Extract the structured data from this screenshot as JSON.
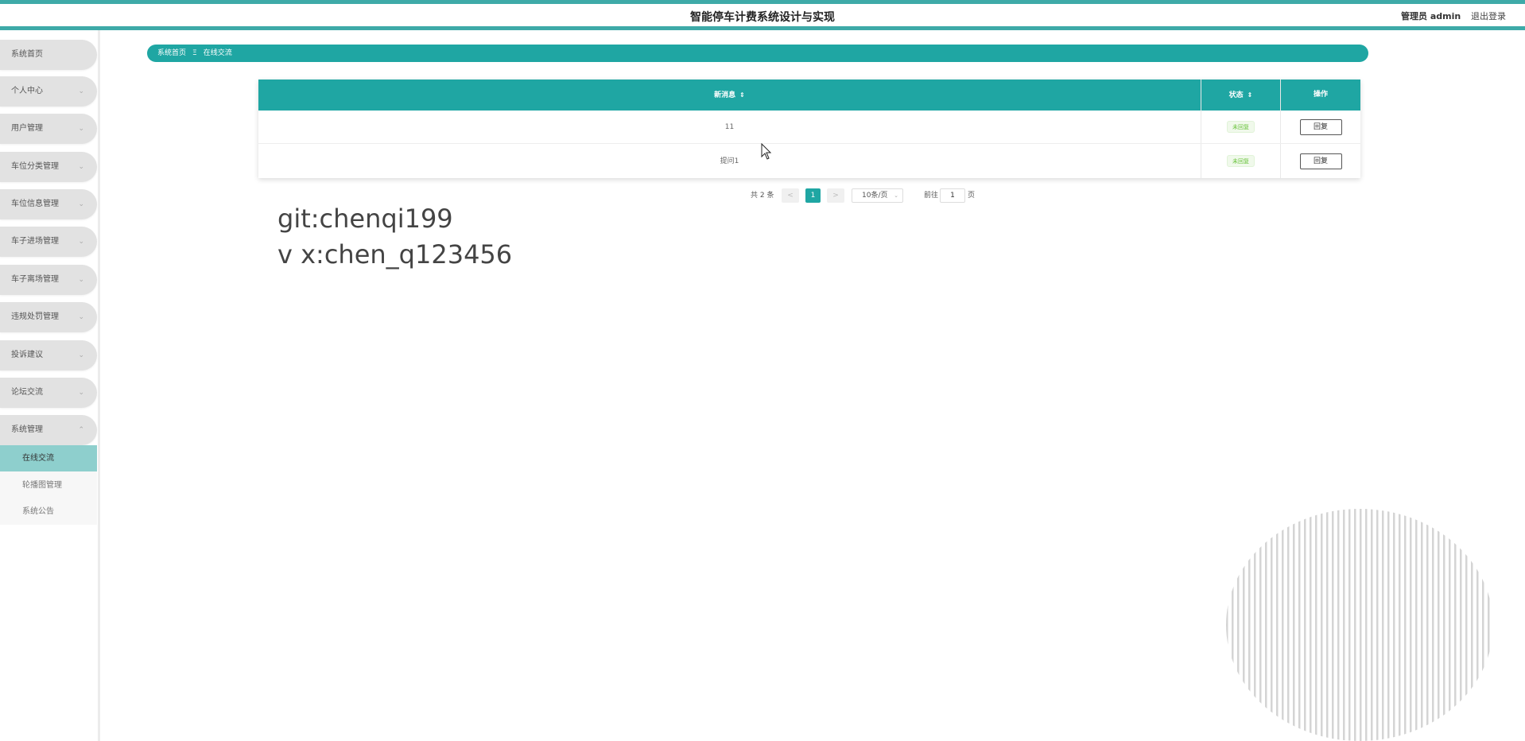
{
  "header": {
    "title": "智能停车计费系统设计与实现",
    "user": "管理员 admin",
    "logout": "退出登录"
  },
  "sidebar": {
    "items": [
      {
        "label": "系统首页",
        "chevron": ""
      },
      {
        "label": "个人中心",
        "chevron": "⌄"
      },
      {
        "label": "用户管理",
        "chevron": "⌄"
      },
      {
        "label": "车位分类管理",
        "chevron": "⌄"
      },
      {
        "label": "车位信息管理",
        "chevron": "⌄"
      },
      {
        "label": "车子进场管理",
        "chevron": "⌄"
      },
      {
        "label": "车子离场管理",
        "chevron": "⌄"
      },
      {
        "label": "违规处罚管理",
        "chevron": "⌄"
      },
      {
        "label": "投诉建议",
        "chevron": "⌄"
      },
      {
        "label": "论坛交流",
        "chevron": "⌄"
      },
      {
        "label": "系统管理",
        "chevron": "⌃"
      }
    ],
    "sub_items": [
      {
        "label": "在线交流",
        "active": true
      },
      {
        "label": "轮播图管理",
        "active": false
      },
      {
        "label": "系统公告",
        "active": false
      }
    ]
  },
  "breadcrumb": {
    "home": "系统首页",
    "separator": "Ξ",
    "current": "在线交流"
  },
  "table": {
    "columns": {
      "message": "新消息",
      "status": "状态",
      "action": "操作"
    },
    "sort_icon": "⇕",
    "rows": [
      {
        "message": "11",
        "status": "未回复",
        "action": "回复"
      },
      {
        "message": "提问1",
        "status": "未回复",
        "action": "回复"
      }
    ]
  },
  "pagination": {
    "total": "共 2 条",
    "prev": "<",
    "current_page": "1",
    "next": ">",
    "page_size": "10条/页",
    "goto_label": "前往",
    "goto_value": "1",
    "page_suffix": "页"
  },
  "watermark": {
    "line1": "git:chenqi199",
    "line2": "v x:chen_q123456"
  },
  "colors": {
    "accent": "#1fa6a3",
    "accent_light": "#8ecfcd",
    "tag_green": "#67c23a"
  }
}
